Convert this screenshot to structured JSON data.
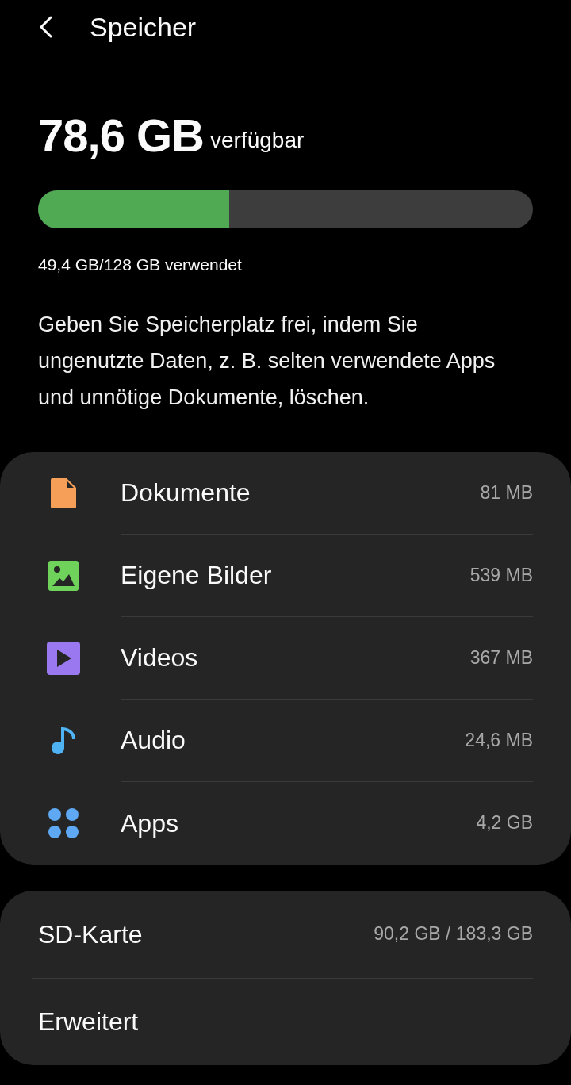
{
  "header": {
    "title": "Speicher"
  },
  "summary": {
    "available_value": "78,6 GB",
    "available_label": "verfügbar",
    "level": 0.386,
    "used_text": "49,4 GB/128 GB verwendet"
  },
  "hint": "Geben Sie Speicherplatz frei, indem Sie ungenutzte Daten, z. B. selten verwendete Apps und unnötige Dokumente, löschen.",
  "categories": [
    {
      "kind": "document",
      "color": "#f59f58",
      "label": "Dokumente",
      "size": "81 MB"
    },
    {
      "kind": "image",
      "color": "#6fd35b",
      "label": "Eigene Bilder",
      "size": "539 MB"
    },
    {
      "kind": "video",
      "color": "#9a78f0",
      "label": "Videos",
      "size": "367 MB"
    },
    {
      "kind": "audio",
      "color": "#4fb2f3",
      "label": "Audio",
      "size": "24,6 MB"
    },
    {
      "kind": "apps",
      "color": "#5ea8f4",
      "label": "Apps",
      "size": "4,2 GB"
    }
  ],
  "extras": [
    {
      "label": "SD-Karte",
      "value": "90,2 GB / 183,3 GB"
    },
    {
      "label": "Erweitert"
    }
  ]
}
